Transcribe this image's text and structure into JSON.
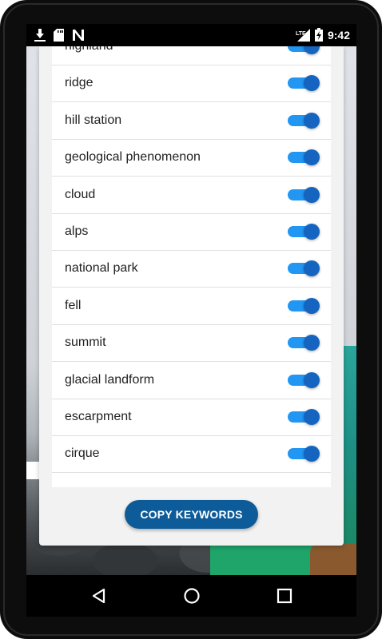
{
  "status_bar": {
    "time": "9:42",
    "network": "LTE",
    "left_icons": [
      "download-icon",
      "sd-card-icon",
      "n-app-icon"
    ],
    "right_icons": [
      "signal-icon",
      "battery-charging-icon"
    ]
  },
  "keywords": [
    {
      "label": "highland",
      "enabled": true
    },
    {
      "label": "ridge",
      "enabled": true
    },
    {
      "label": "hill station",
      "enabled": true
    },
    {
      "label": "geological phenomenon",
      "enabled": true
    },
    {
      "label": "cloud",
      "enabled": true
    },
    {
      "label": "alps",
      "enabled": true
    },
    {
      "label": "national park",
      "enabled": true
    },
    {
      "label": "fell",
      "enabled": true
    },
    {
      "label": "summit",
      "enabled": true
    },
    {
      "label": "glacial landform",
      "enabled": true
    },
    {
      "label": "escarpment",
      "enabled": true
    },
    {
      "label": "cirque",
      "enabled": true
    }
  ],
  "copy_button_label": "COPY KEYWORDS",
  "nav": [
    "back-icon",
    "home-icon",
    "recents-icon"
  ],
  "colors": {
    "accent": "#0d5c99",
    "switch_track": "#2196f3",
    "switch_thumb": "#1565c0"
  }
}
